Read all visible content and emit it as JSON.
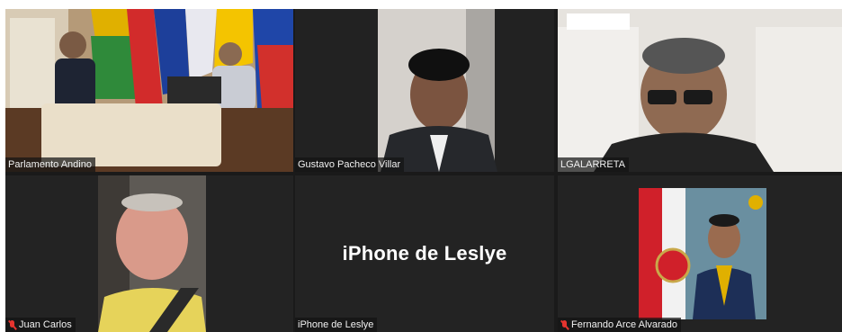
{
  "meeting": {
    "participants": [
      {
        "id": "p1",
        "name": "Parlamento Andino",
        "muted": false,
        "video": true
      },
      {
        "id": "p2",
        "name": "Gustavo Pacheco Villar",
        "muted": false,
        "video": true
      },
      {
        "id": "p3",
        "name": "LGALARRETA",
        "muted": false,
        "video": true,
        "active_speaker": true
      },
      {
        "id": "p4",
        "name": "Juan Carlos",
        "muted": true,
        "video": true
      },
      {
        "id": "p5",
        "name": "iPhone de Leslye",
        "muted": false,
        "video": false,
        "display_name": "iPhone de Leslye"
      },
      {
        "id": "p6",
        "name": "Fernando Arce Alvarado",
        "muted": true,
        "video": true
      }
    ]
  },
  "colors": {
    "active_speaker_border": "#2ab03a",
    "muted_icon": "#e5342f",
    "tile_background": "#232323"
  },
  "icons": {
    "muted": "microphone-muted-icon"
  }
}
